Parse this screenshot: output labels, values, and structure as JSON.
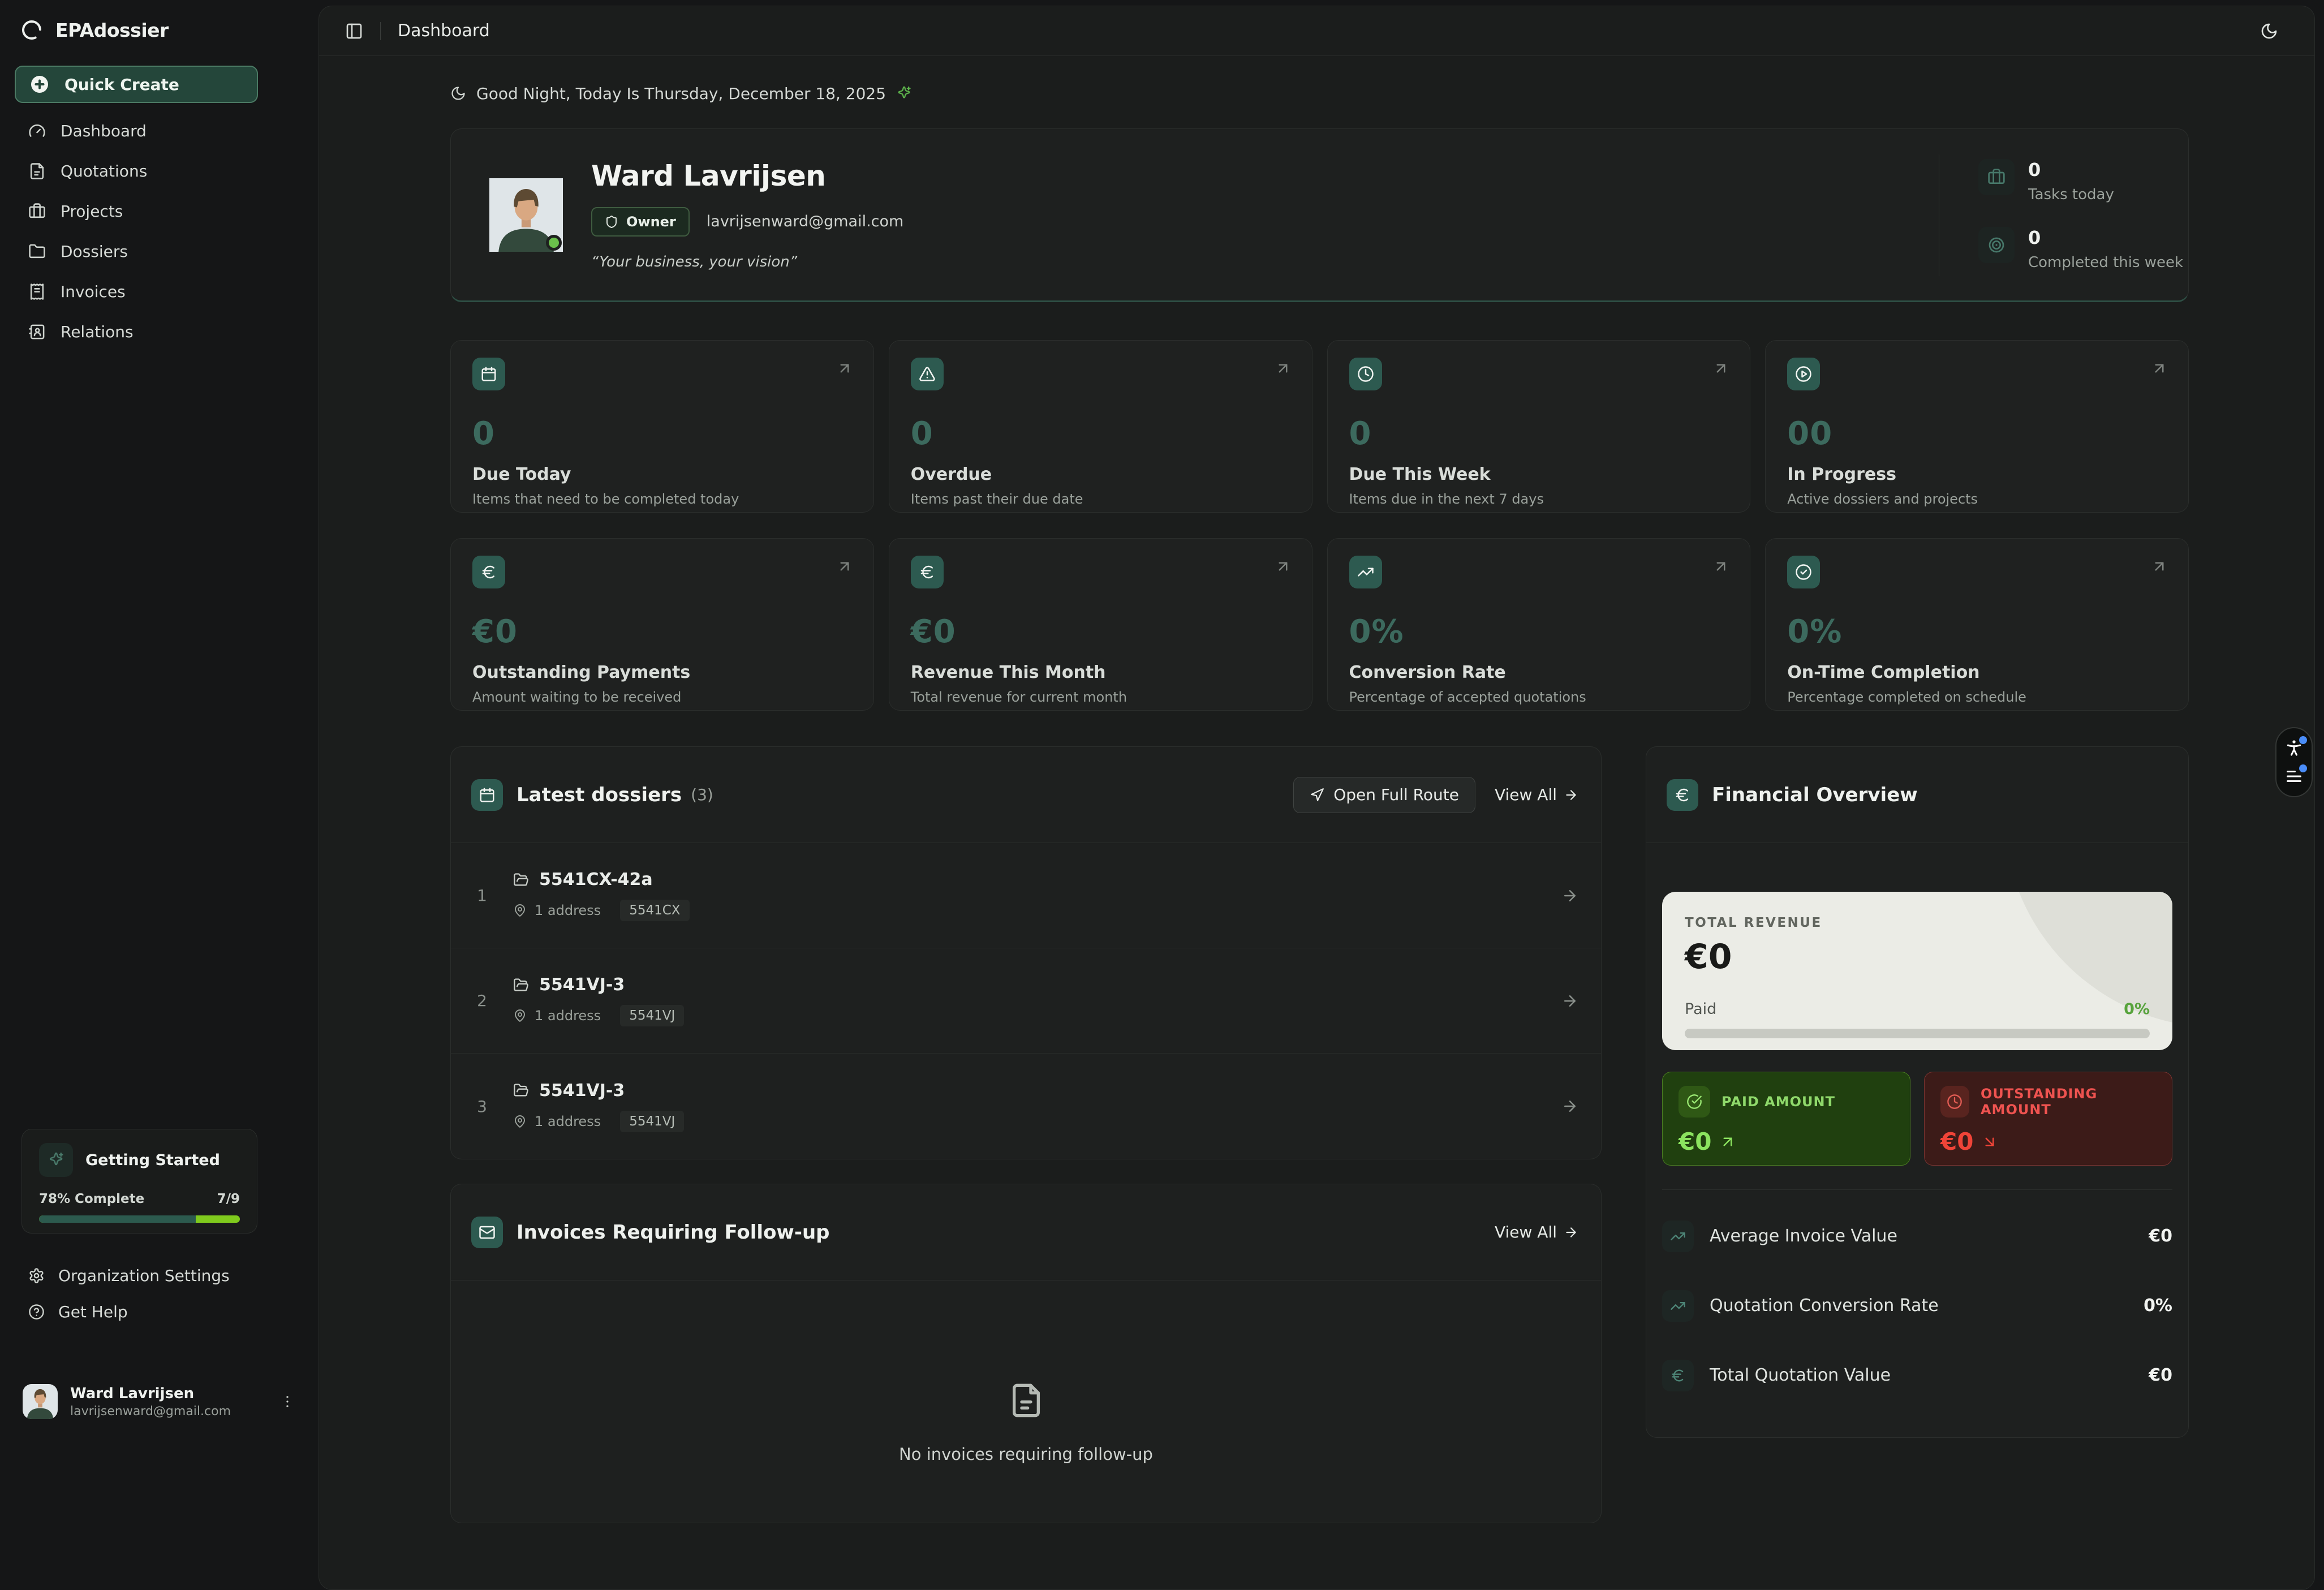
{
  "app": {
    "name": "EPAdossier"
  },
  "sidebar": {
    "quick_create": {
      "label": "Quick Create",
      "icon": "plus-circle"
    },
    "items": [
      {
        "label": "Dashboard",
        "icon": "gauge"
      },
      {
        "label": "Quotations",
        "icon": "file-text"
      },
      {
        "label": "Projects",
        "icon": "briefcase"
      },
      {
        "label": "Dossiers",
        "icon": "folder"
      },
      {
        "label": "Invoices",
        "icon": "receipt"
      },
      {
        "label": "Relations",
        "icon": "contact"
      }
    ],
    "getting_started": {
      "title": "Getting Started",
      "icon": "sparkles",
      "progress_label": "78% Complete",
      "steps": "7/9",
      "percent": 78
    },
    "footer_items": [
      {
        "label": "Organization Settings",
        "icon": "settings"
      },
      {
        "label": "Get Help",
        "icon": "help-circle"
      }
    ],
    "user": {
      "name": "Ward Lavrijsen",
      "email": "lavrijsenward@gmail.com"
    }
  },
  "topbar": {
    "title": "Dashboard"
  },
  "greeting": {
    "text": "Good Night, Today Is Thursday, December 18, 2025",
    "icon": "moon",
    "sparkle_icon": "sparkles"
  },
  "profile": {
    "name": "Ward Lavrijsen",
    "role": "Owner",
    "email": "lavrijsenward@gmail.com",
    "quote": "“Your business, your vision”",
    "stats": [
      {
        "value": "0",
        "label": "Tasks today",
        "icon": "briefcase"
      },
      {
        "value": "0",
        "label": "Completed this week",
        "icon": "target"
      }
    ]
  },
  "stat_cards": [
    {
      "icon": "calendar",
      "value": "0",
      "title": "Due Today",
      "subtitle": "Items that need to be completed today"
    },
    {
      "icon": "alert-triangle",
      "value": "0",
      "title": "Overdue",
      "subtitle": "Items past their due date"
    },
    {
      "icon": "clock",
      "value": "0",
      "title": "Due This Week",
      "subtitle": "Items due in the next 7 days"
    },
    {
      "icon": "play-circle",
      "value": "00",
      "title": "In Progress",
      "subtitle": "Active dossiers and projects"
    },
    {
      "icon": "euro",
      "value": "€0",
      "title": "Outstanding Payments",
      "subtitle": "Amount waiting to be received"
    },
    {
      "icon": "euro",
      "value": "€0",
      "title": "Revenue This Month",
      "subtitle": "Total revenue for current month"
    },
    {
      "icon": "trending-up",
      "value": "0%",
      "title": "Conversion Rate",
      "subtitle": "Percentage of accepted quotations"
    },
    {
      "icon": "check-circle",
      "value": "0%",
      "title": "On-Time Completion",
      "subtitle": "Percentage completed on schedule"
    }
  ],
  "dossiers": {
    "icon": "calendar",
    "title": "Latest dossiers",
    "count": "(3)",
    "open_route_label": "Open Full Route",
    "view_all_label": "View All",
    "rows": [
      {
        "index": "1",
        "name": "5541CX-42a",
        "addresses": "1 address",
        "postcode": "5541CX"
      },
      {
        "index": "2",
        "name": "5541VJ-3",
        "addresses": "1 address",
        "postcode": "5541VJ"
      },
      {
        "index": "3",
        "name": "5541VJ-3",
        "addresses": "1 address",
        "postcode": "5541VJ"
      }
    ]
  },
  "invoices": {
    "icon": "mail",
    "title": "Invoices Requiring Follow-up",
    "view_all_label": "View All",
    "empty_text": "No invoices requiring follow-up"
  },
  "financial": {
    "icon": "euro",
    "title": "Financial Overview",
    "total_revenue_label": "TOTAL REVENUE",
    "total_revenue_value": "€0",
    "paid_label": "Paid",
    "paid_percent": "0%",
    "paid_fill_percent": 0,
    "paid_amount": {
      "label": "PAID AMOUNT",
      "value": "€0",
      "icon": "circle-check-big",
      "trend_icon": "arrow-up-right"
    },
    "outstanding_amount": {
      "label": "OUTSTANDING AMOUNT",
      "value": "€0",
      "icon": "clock",
      "trend_icon": "arrow-down-right"
    },
    "metrics": [
      {
        "icon": "trending-up",
        "label": "Average Invoice Value",
        "value": "€0"
      },
      {
        "icon": "trending-up",
        "label": "Quotation Conversion Rate",
        "value": "0%"
      },
      {
        "icon": "euro",
        "label": "Total Quotation Value",
        "value": "€0"
      }
    ]
  },
  "colors": {
    "accent_teal": "#2d5a50",
    "teal_number": "#3c6a5e",
    "lime_progress": "#7fca1d",
    "paid_green": "#8be35f",
    "outstanding_red": "#f04438",
    "status_online": "#6abf4b",
    "widget_dot_blue": "#4a8df8",
    "light_card": "#ebece6"
  }
}
